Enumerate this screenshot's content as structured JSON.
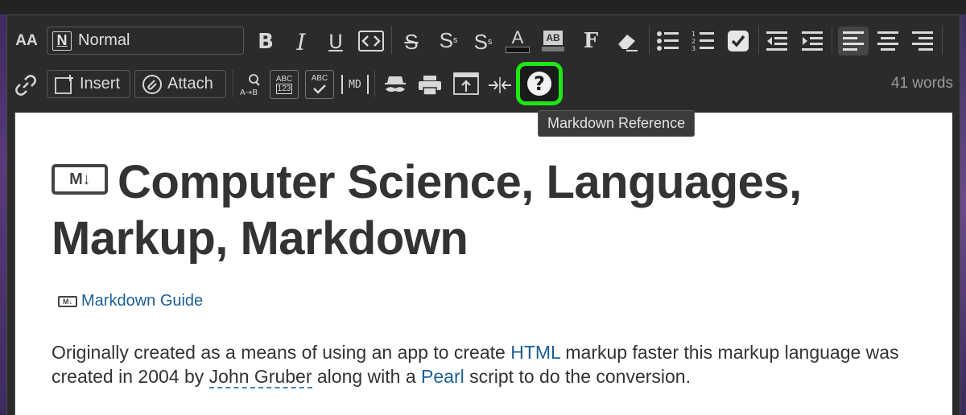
{
  "toolbar": {
    "style_value": "Normal",
    "insert_label": "Insert",
    "attach_label": "Attach",
    "word_count": "41 words",
    "tooltip": "Markdown Reference",
    "font_size_icon_label": "AA",
    "font_icon_label": "F",
    "md_icon_label": "MD",
    "abc_label": "ABC",
    "digits_label": "123",
    "ab_label": "AB",
    "help_glyph": "?"
  },
  "document": {
    "heading": "Computer Science, Languages, Markup, Markdown",
    "md_badge": "M↓",
    "guide_link": "Markdown Guide",
    "guide_icon": "M↓",
    "paragraph": {
      "t1": "Originally created as a means of using an app to create ",
      "link_html": "HTML",
      "t2": " markup faster this markup language was created in 2004 by ",
      "name": "John Gruber",
      "t3": " along with a ",
      "link_pearl": "Pearl",
      "t4": " script to do the conversion."
    }
  },
  "colors": {
    "highlight": "#1ee616",
    "link": "#1b5f96"
  }
}
